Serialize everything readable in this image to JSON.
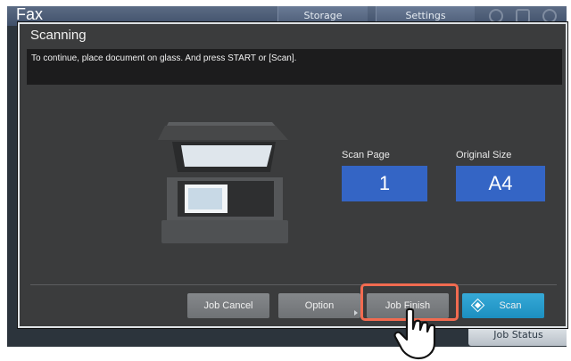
{
  "background": {
    "app_title": "Fax",
    "tabs": [
      "Storage",
      "Settings"
    ],
    "job_status_label": "Job Status"
  },
  "dialog": {
    "title": "Scanning",
    "message": "To continue, place document on glass. And press START or [Scan].",
    "scan_page": {
      "label": "Scan Page",
      "value": "1"
    },
    "original_size": {
      "label": "Original Size",
      "value": "A4"
    },
    "buttons": {
      "job_cancel": "Job Cancel",
      "option": "Option",
      "job_finish": "Job Finish",
      "scan": "Scan"
    }
  },
  "colors": {
    "value_box": "#3465c5",
    "scan_button": "#1c8fc0",
    "highlight": "#f26b50",
    "dialog_bg": "#3b3c3d"
  },
  "icons": [
    "scanner-icon",
    "scan-diamond-icon",
    "pointing-hand-icon",
    "home-icon",
    "lock-icon",
    "help-icon"
  ]
}
